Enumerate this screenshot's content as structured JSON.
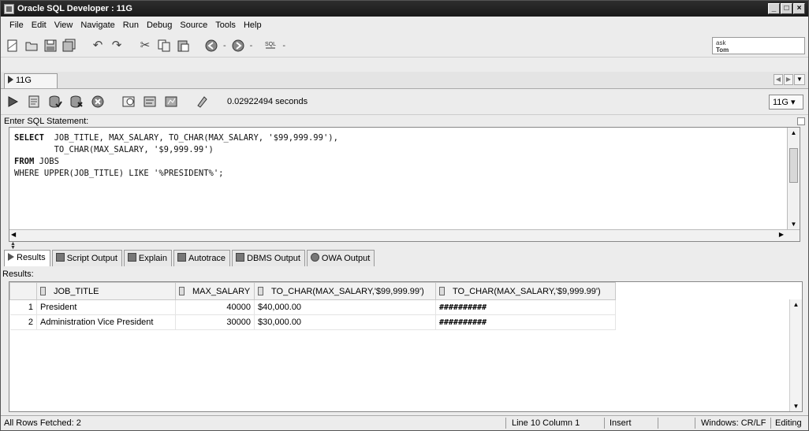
{
  "window": {
    "title": "Oracle SQL Developer : 11G",
    "controls": [
      "_",
      "□",
      "×"
    ]
  },
  "menu": [
    "File",
    "Edit",
    "View",
    "Navigate",
    "Run",
    "Debug",
    "Source",
    "Tools",
    "Help"
  ],
  "toolbar": {
    "ask_box": [
      "ask",
      "Tom"
    ]
  },
  "connection_tab": {
    "label": "11G"
  },
  "worksheet": {
    "exec_time": "0.02922494 seconds",
    "connection": "11G ▾",
    "enter_label": "Enter SQL Statement:"
  },
  "sql": {
    "lines": [
      "SELECT  JOB_TITLE, MAX_SALARY, TO_CHAR(MAX_SALARY, '$99,999.99'),",
      "        TO_CHAR(MAX_SALARY, '$9,999.99')",
      "FROM JOBS",
      "WHERE UPPER(JOB_TITLE) LIKE '%PRESIDENT%';"
    ]
  },
  "result_tabs": [
    "Results",
    "Script Output",
    "Explain",
    "Autotrace",
    "DBMS Output",
    "OWA Output"
  ],
  "results": {
    "label": "Results:",
    "columns": [
      "JOB_TITLE",
      "MAX_SALARY",
      "TO_CHAR(MAX_SALARY,'$99,999.99')",
      "TO_CHAR(MAX_SALARY,'$9,999.99')"
    ],
    "rows": [
      {
        "n": "1",
        "job_title": "President",
        "max_salary": "40000",
        "fmt1": "$40,000.00",
        "fmt2": "##########"
      },
      {
        "n": "2",
        "job_title": "Administration Vice President",
        "max_salary": "30000",
        "fmt1": "$30,000.00",
        "fmt2": "##########"
      }
    ]
  },
  "status": {
    "left": "All Rows Fetched: 2",
    "position": "Line 10 Column 1",
    "mode": "Insert",
    "line_endings": "Windows: CR/LF",
    "state": "Editing"
  }
}
